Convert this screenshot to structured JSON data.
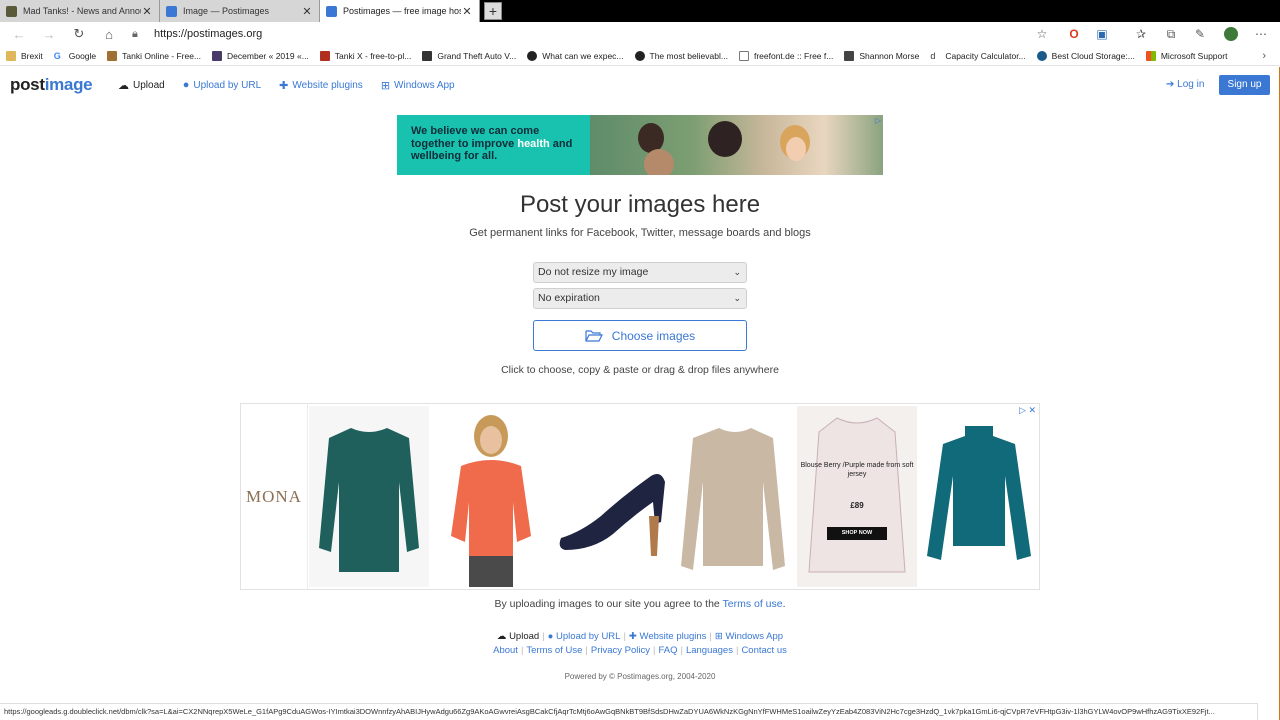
{
  "browser": {
    "tabs": [
      {
        "title": "Mad Tanks! - News and Announ",
        "favicon_color": "#5a5a3a",
        "active": false
      },
      {
        "title": "Image — Postimages",
        "favicon_color": "#3a78d4",
        "active": false
      },
      {
        "title": "Postimages — free image hostin",
        "favicon_color": "#3a78d4",
        "active": true
      }
    ],
    "new_tab_label": "+",
    "url": "https://postimages.org",
    "bookmarks": [
      {
        "label": "Brexit",
        "color": "#c89b3c"
      },
      {
        "label": "Google",
        "color": "#4285f4"
      },
      {
        "label": "Tanki Online - Free...",
        "color": "#a07030"
      },
      {
        "label": "December « 2019 «...",
        "color": "#4a3a6a"
      },
      {
        "label": "Tanki X - free-to-pl...",
        "color": "#b03020"
      },
      {
        "label": "Grand Theft Auto V...",
        "color": "#333333"
      },
      {
        "label": "What can we expec...",
        "color": "#222222"
      },
      {
        "label": "The most believabl...",
        "color": "#222222"
      },
      {
        "label": "freefont.de :: Free f...",
        "color": "#777777"
      },
      {
        "label": "Shannon Morse",
        "color": "#444444"
      },
      {
        "label": "Capacity Calculator...",
        "color": "#333333"
      },
      {
        "label": "Best Cloud Storage:...",
        "color": "#1a5a8a"
      },
      {
        "label": "Microsoft Support",
        "color": "#f25022"
      }
    ]
  },
  "header": {
    "logo_a": "post",
    "logo_b": "image",
    "nav": [
      {
        "label": "Upload",
        "icon": "cloud-upload-icon",
        "current": true
      },
      {
        "label": "Upload by URL",
        "icon": "globe-icon",
        "current": false
      },
      {
        "label": "Website plugins",
        "icon": "puzzle-icon",
        "current": false
      },
      {
        "label": "Windows App",
        "icon": "windows-icon",
        "current": false
      }
    ],
    "login_label": "Log in",
    "signup_label": "Sign up"
  },
  "top_ad": {
    "line_a": "We believe we can come together to improve ",
    "line_highlight": "health",
    "line_b": " and wellbeing for all."
  },
  "main": {
    "title": "Post your images here",
    "subtitle": "Get permanent links for Facebook, Twitter, message boards and blogs",
    "resize_select": "Do not resize my image",
    "expiration_select": "No expiration",
    "choose_label": "Choose images",
    "hint": "Click to choose, copy & paste or drag & drop files anywhere"
  },
  "product_ad": {
    "brand": "MONA",
    "blouse_text": "Blouse Berry /Purple made from soft jersey",
    "blouse_price": "£89",
    "shop_now": "SHOP NOW"
  },
  "footer": {
    "terms_prefix": "By uploading images to our site you agree to the ",
    "terms_link": "Terms of use",
    "terms_suffix": ".",
    "nav1": [
      "Upload",
      "Upload by URL",
      "Website plugins",
      "Windows App"
    ],
    "nav2": [
      "About",
      "Terms of Use",
      "Privacy Policy",
      "FAQ",
      "Languages",
      "Contact us"
    ],
    "powered": "Powered by © Postimages.org, 2004-2020"
  },
  "status_url": "https://googleads.g.doubleclick.net/dbm/clk?sa=L&ai=CX2NNqrepX5WeLe_G1fAPg9CduAGWos-IYImtkai3DOWnnfzyAhABIJHywAdgu66Zg9AKoAGwvreiAsgBCakCfjAqrTcMtj6oAwGqBNkBT9BfSdsDHwZaDYUA6WkNzKGgNnYfFWHMeS1oailwZeyYzEab4Z083ViN2Hc7cge3HzdQ_1vk7pka1GmLi6-qjCVpR7eVFHtpG3iv-1l3hGYLW4ovOP9wHfhzAG9TixXE92Fjt..."
}
